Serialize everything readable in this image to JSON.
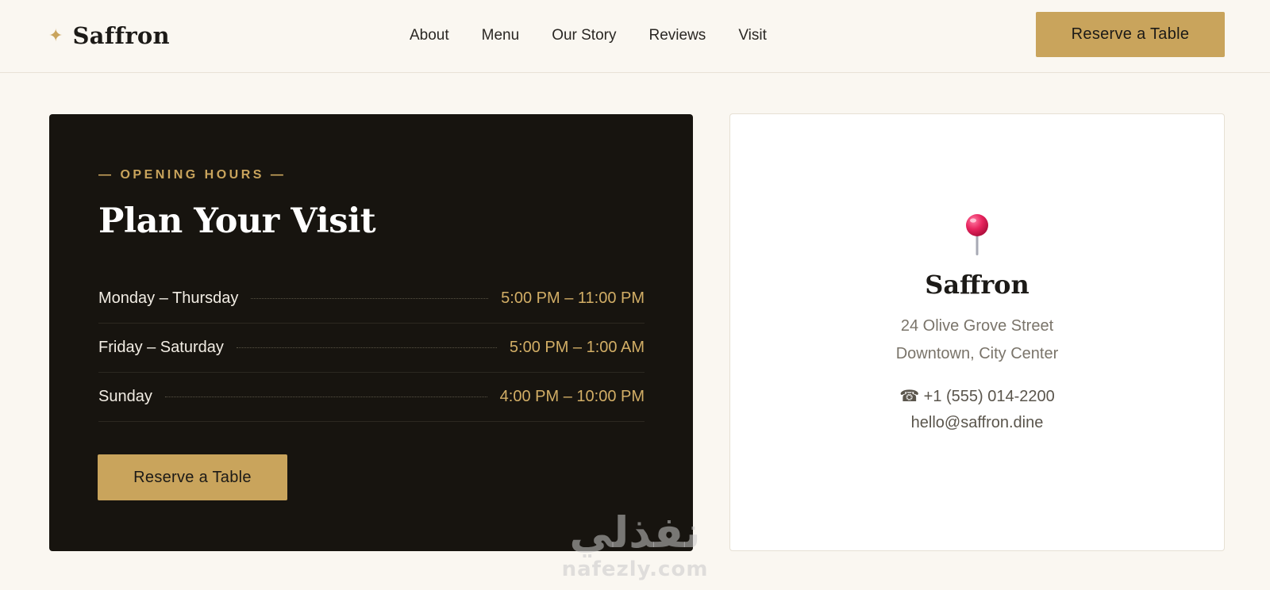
{
  "nav": {
    "brand_icon": "sparkle-icon",
    "brand_name": "Saffron",
    "links": [
      "About",
      "Menu",
      "Our Story",
      "Reviews",
      "Visit"
    ],
    "cta_label": "Reserve a Table"
  },
  "hours": {
    "eyebrow": "— OPENING HOURS —",
    "title": "Plan Your Visit",
    "rows": [
      {
        "day": "Monday – Thursday",
        "time": "5:00 PM – 11:00 PM"
      },
      {
        "day": "Friday – Saturday",
        "time": "5:00 PM – 1:00 AM"
      },
      {
        "day": "Sunday",
        "time": "4:00 PM – 10:00 PM"
      }
    ],
    "cta_label": "Reserve a Table"
  },
  "info": {
    "icon": "map-pin-icon",
    "name": "Saffron",
    "address_line1": "24 Olive Grove Street",
    "address_line2": "Downtown, City Center",
    "phone": "☎ +1 (555) 014-2200",
    "email": "hello@saffron.dine"
  },
  "watermark": {
    "arabic": "نفذلي",
    "latin": "nafezly.com"
  },
  "colors": {
    "accent": "#c9a45c",
    "page_background": "#faf7f1",
    "dark_card": "#17140f",
    "time_text": "#d2ae66"
  }
}
